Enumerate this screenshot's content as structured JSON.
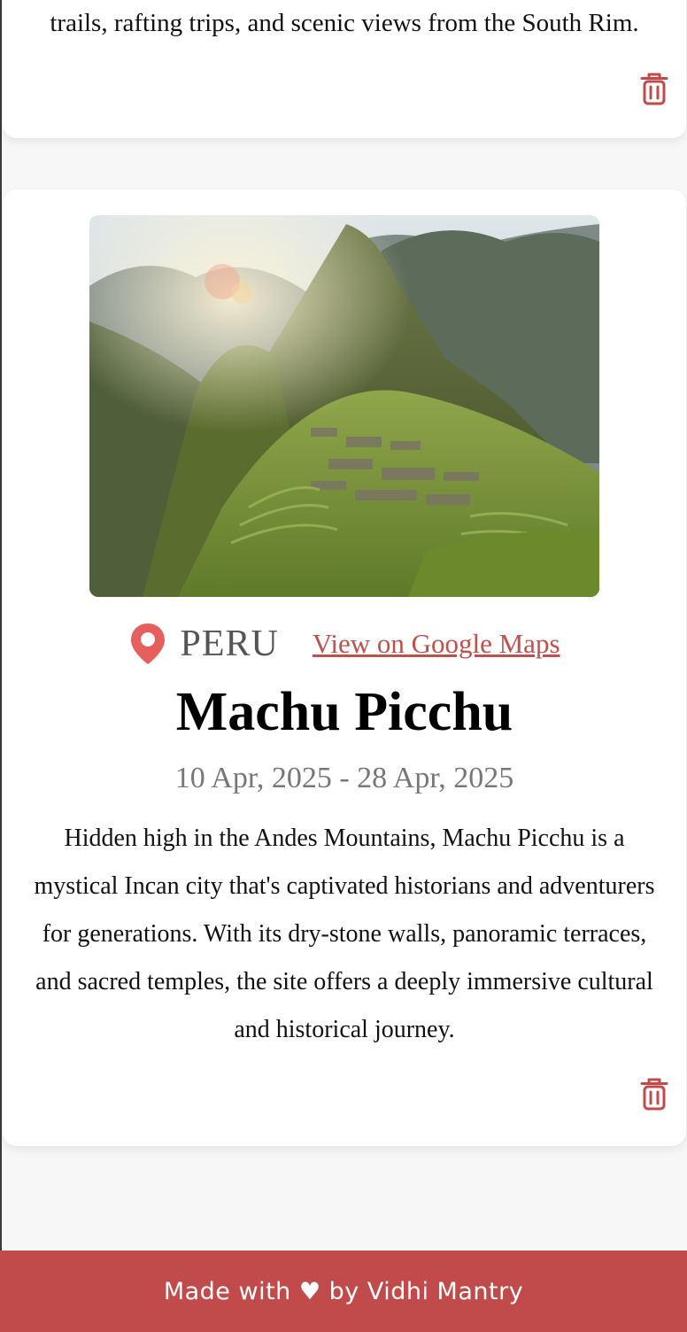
{
  "previous_card": {
    "description_tail": "trails, rafting trips, and scenic views from the South Rim.",
    "delete_icon": "trash-icon"
  },
  "destination": {
    "image_subject": "Machu Picchu mountain ruins",
    "pin_icon": "location-pin-icon",
    "country": "PERU",
    "maps_link_label": "View on Google Maps",
    "title": "Machu Picchu",
    "dates": "10 Apr, 2025 - 28 Apr, 2025",
    "description": "Hidden high in the Andes Mountains, Machu Picchu is a mystical Incan city that's captivated historians and adventurers for generations. With its dry-stone walls, panoramic terraces, and sacred temples, the site offers a deeply immersive cultural and historical journey.",
    "delete_icon": "trash-icon"
  },
  "footer": {
    "text": "Made with ♥ by Vidhi Mantry"
  },
  "colors": {
    "accent": "#c14b4a",
    "link": "#c0504d",
    "pin": "#e5605d"
  }
}
